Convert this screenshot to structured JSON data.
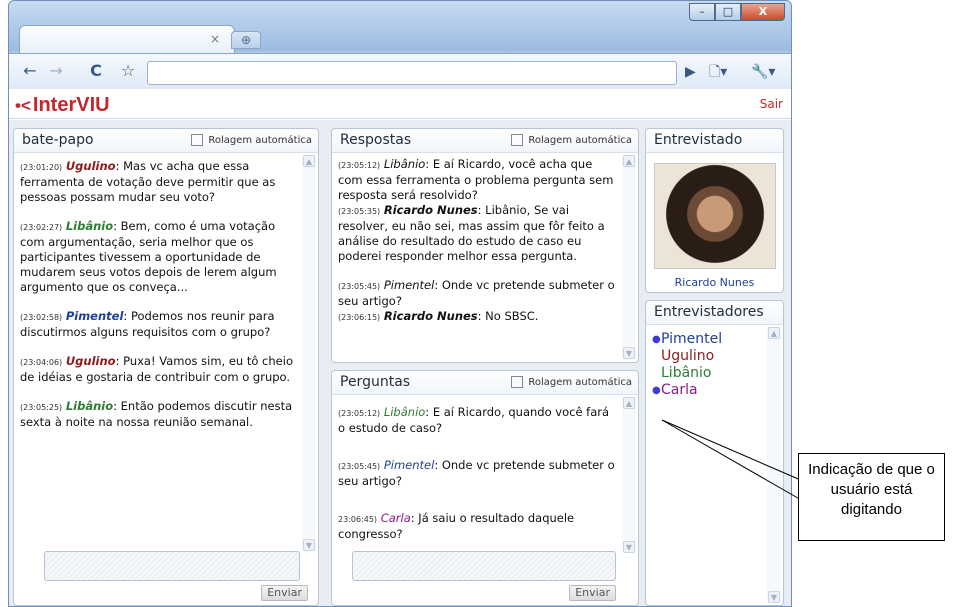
{
  "browser": {
    "tab_close": "×",
    "new_tab": "⊕",
    "minimize": "–",
    "maximize": "□",
    "close": "X",
    "back": "←",
    "forward": "→",
    "reload": "C",
    "star": "☆",
    "go": "▶",
    "page_menu": "🗋▾",
    "tools_menu": "🔧▾"
  },
  "app": {
    "logo": "InterVIU",
    "logo_mark": "•<",
    "logout": "Sair"
  },
  "chat": {
    "title": "bate-papo",
    "auto_scroll": "Rolagem automática",
    "send": "Enviar",
    "messages": [
      {
        "time": "(23:01:20)",
        "user": "Ugulino",
        "text": ": Mas vc acha que essa ferramenta de votação deve permitir que as pessoas possam mudar seu voto?"
      },
      {
        "time": "(23:02:27)",
        "user": "Libânio",
        "text": ": Bem, como é uma votação com argumentação, seria melhor que os participantes tivessem a oportunidade de mudarem seus votos depois de lerem algum argumento que os conveça..."
      },
      {
        "time": "(23:02:58)",
        "user": "Pimentel",
        "text": ": Podemos nos reunir para discutirmos alguns requisitos com o grupo?"
      },
      {
        "time": "(23:04:06)",
        "user": "Ugulino",
        "text": ": Puxa! Vamos sim, eu tô cheio de idéias e gostaria de contribuir com o grupo."
      },
      {
        "time": "(23:05:25)",
        "user": "Libânio",
        "text": ": Então podemos discutir nesta sexta à noite na nossa reunião semanal."
      }
    ]
  },
  "answers": {
    "title": "Respostas",
    "auto_scroll": "Rolagem automática",
    "messages": [
      {
        "time": "(23:05:12)",
        "user": "Libânio",
        "text": ": E aí Ricardo, você acha que com essa ferramenta o problema pergunta sem resposta será resolvido?"
      },
      {
        "time": "(23:05:35)",
        "user": "Ricardo Nunes",
        "text": ": Libânio, Se vai resolver, eu não sei, mas assim que fôr feito a análise do resultado do estudo de caso eu poderei responder melhor essa pergunta."
      },
      {
        "time": "(23:05:45)",
        "user": "Pimentel",
        "text": ": Onde vc pretende submeter o seu artigo?"
      },
      {
        "time": "(23:06:15)",
        "user": "Ricardo Nunes",
        "text": ": No SBSC."
      }
    ]
  },
  "questions": {
    "title": "Perguntas",
    "auto_scroll": "Rolagem automática",
    "send": "Enviar",
    "messages": [
      {
        "time": "(23:05:12)",
        "user": "Libânio",
        "text": ": E aí Ricardo, quando você fará o estudo de caso?"
      },
      {
        "time": "(23:05:45)",
        "user": "Pimentel",
        "text": ": Onde vc pretende submeter o seu artigo?"
      },
      {
        "time": "23:06:45)",
        "user": "Carla",
        "text": ": Já saiu o resultado daquele congresso?"
      }
    ]
  },
  "interviewee": {
    "title": "Entrevistado",
    "name": "Ricardo Nunes"
  },
  "interviewers": {
    "title": "Entrevistadores",
    "items": [
      {
        "name": "Pimentel",
        "typing": true,
        "color": "#1f3f9a"
      },
      {
        "name": "Ugulino",
        "typing": false,
        "color": "#8b1a1a"
      },
      {
        "name": "Libânio",
        "typing": false,
        "color": "#2e7d32"
      },
      {
        "name": "Carla",
        "typing": true,
        "color": "#8b1a8b"
      }
    ]
  },
  "callout": {
    "text": "Indicação de que o usuário está digitando"
  }
}
